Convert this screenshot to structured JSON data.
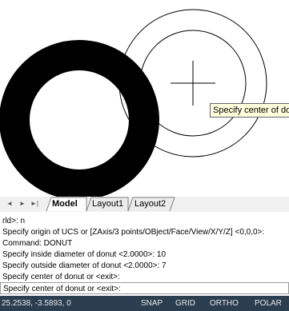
{
  "tooltip": {
    "text": "Specify center of donut or <exit>:"
  },
  "tabs": {
    "nav_first": "◄",
    "nav_prev": "►",
    "nav_next": "►|",
    "items": [
      "Model",
      "Layout1",
      "Layout2"
    ]
  },
  "command_history": {
    "lines": [
      "rld>: n",
      "Specify origin of UCS or [ZAxis/3 points/OBject/Face/View/X/Y/Z] <0,0,0>:",
      "Command: DONUT",
      "Specify inside diameter of donut <2.0000>: 10",
      "Specify outside diameter of donut <2.0000>: 7",
      "Specify center of donut or <exit>:"
    ]
  },
  "command_line": {
    "prompt": "Specify center of donut or <exit>:"
  },
  "status_bar": {
    "coordinates": "25.2538, -3.5893, 0",
    "toggles": [
      "SNAP",
      "GRID",
      "ORTHO",
      "POLAR"
    ]
  },
  "colors": {
    "donut_fill": "#000000",
    "preview_stroke": "#000000",
    "statusbar_bg": "#2b3e50",
    "tooltip_bg": "#ffffdd"
  }
}
